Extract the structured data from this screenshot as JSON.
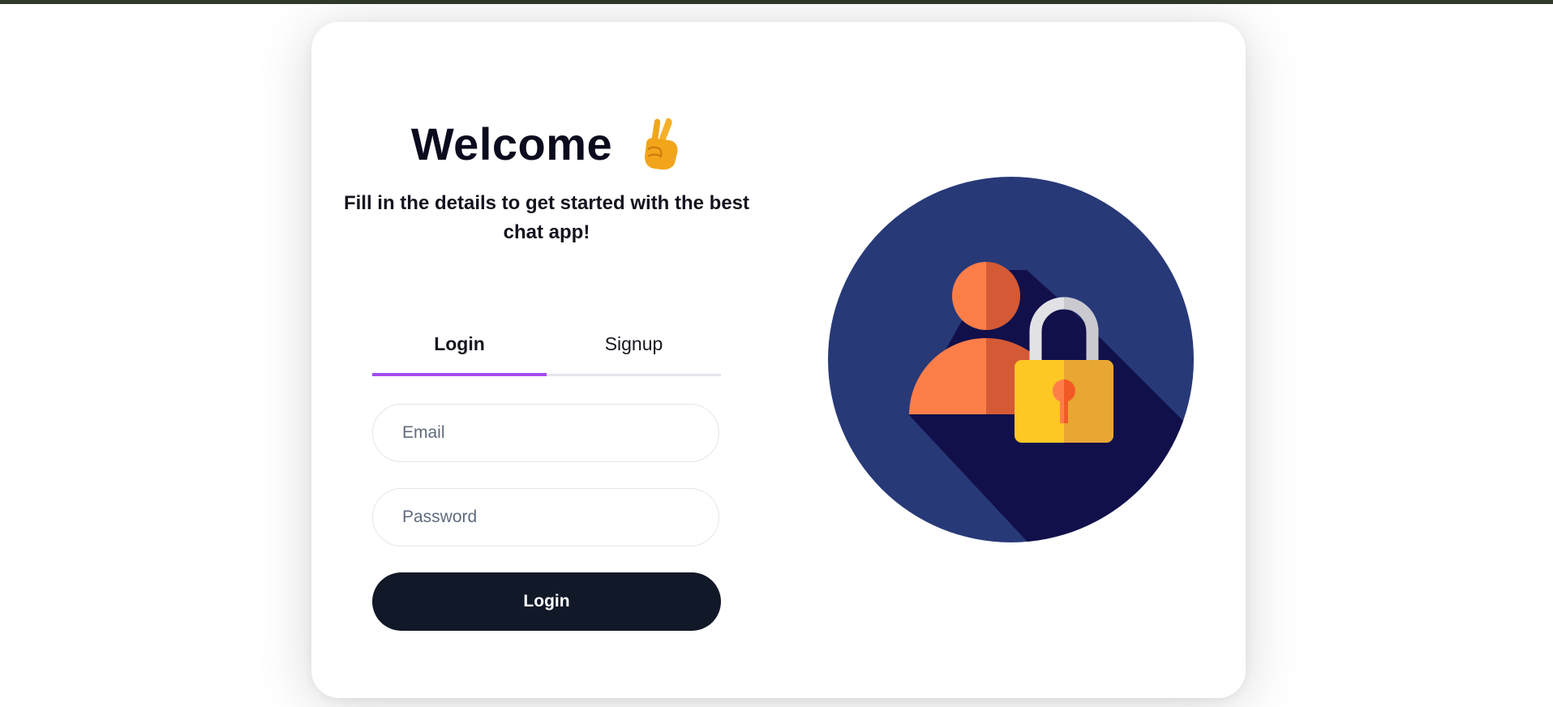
{
  "page": {
    "welcome_title": "Welcome",
    "welcome_icon": "victory-hand-icon",
    "subtitle": "Fill in the details to get started with the best chat app!"
  },
  "tabs": [
    {
      "label": "Login",
      "active": true
    },
    {
      "label": "Signup",
      "active": false
    }
  ],
  "form": {
    "email_placeholder": "Email",
    "email_value": "",
    "password_placeholder": "Password",
    "password_value": "",
    "submit_label": "Login"
  },
  "illustration": {
    "icon": "user-lock-icon"
  },
  "colors": {
    "top_bar": "#2f3a2a",
    "accent": "#a54cf0",
    "button": "#111827",
    "circle": "#283978",
    "shadow": "#12104a",
    "person_light": "#fe7e4a",
    "person_dark": "#d45a35",
    "lock_light": "#fdc724",
    "lock_dark": "#e8a633"
  }
}
